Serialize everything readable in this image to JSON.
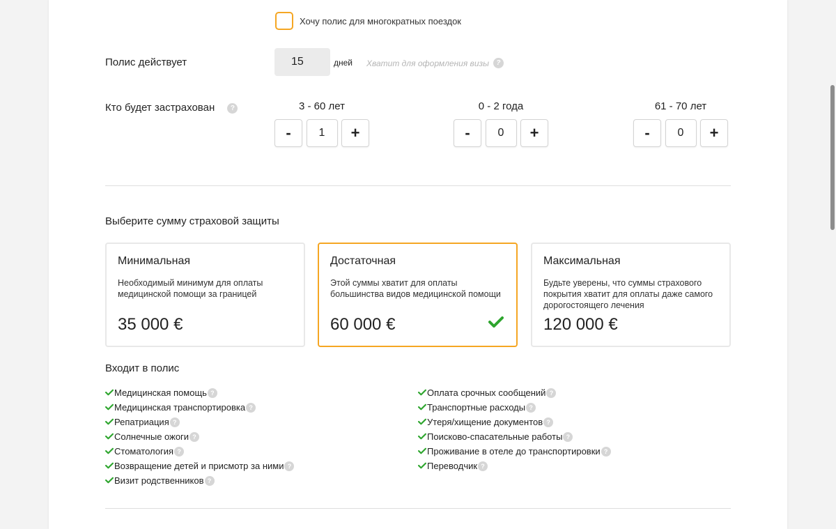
{
  "options": {
    "multi_trip_label": "Хочу полис для многократных поездок"
  },
  "duration": {
    "label": "Полис действует",
    "value": "15",
    "unit": "дней",
    "hint": "Хватит для оформления визы"
  },
  "insured": {
    "label": "Кто будет застрахован",
    "groups": [
      {
        "label": "3 - 60 лет",
        "count": "1",
        "minus": "-",
        "plus": "+"
      },
      {
        "label": "0 - 2 года",
        "count": "0",
        "minus": "-",
        "plus": "+"
      },
      {
        "label": "61 - 70 лет",
        "count": "0",
        "minus": "-",
        "plus": "+"
      }
    ]
  },
  "coverage": {
    "title": "Выберите сумму страховой защиты",
    "selected_index": 1,
    "accent_color": "#f5a623",
    "check_color": "#2ea52e",
    "cards": [
      {
        "title": "Минимальная",
        "description": "Необходимый минимум для оплаты медицинской помощи за границей",
        "price": "35 000  €"
      },
      {
        "title": "Достаточная",
        "description": "Этой суммы хватит для оплаты большинства видов медицинской помощи",
        "price": "60 000  €"
      },
      {
        "title": "Максимальная",
        "description": "Будьте уверены, что суммы страхового покрытия хватит для оплаты даже самого дорогостоящего лечения",
        "price": "120 000  €"
      }
    ]
  },
  "included": {
    "title": "Входит в полис",
    "left": [
      "Медицинская помощь",
      "Медицинская транспортировка",
      "Репатриация",
      "Солнечные ожоги",
      "Стоматология",
      "Возвращение детей и присмотр за ними",
      "Визит родственников"
    ],
    "right": [
      "Оплата срочных сообщений",
      "Транспортные расходы",
      "Утеря/хищение документов",
      "Поисково-спасательные работы",
      "Проживание в отеле до транспортировки",
      "Переводчик"
    ]
  },
  "help_glyph": "?"
}
